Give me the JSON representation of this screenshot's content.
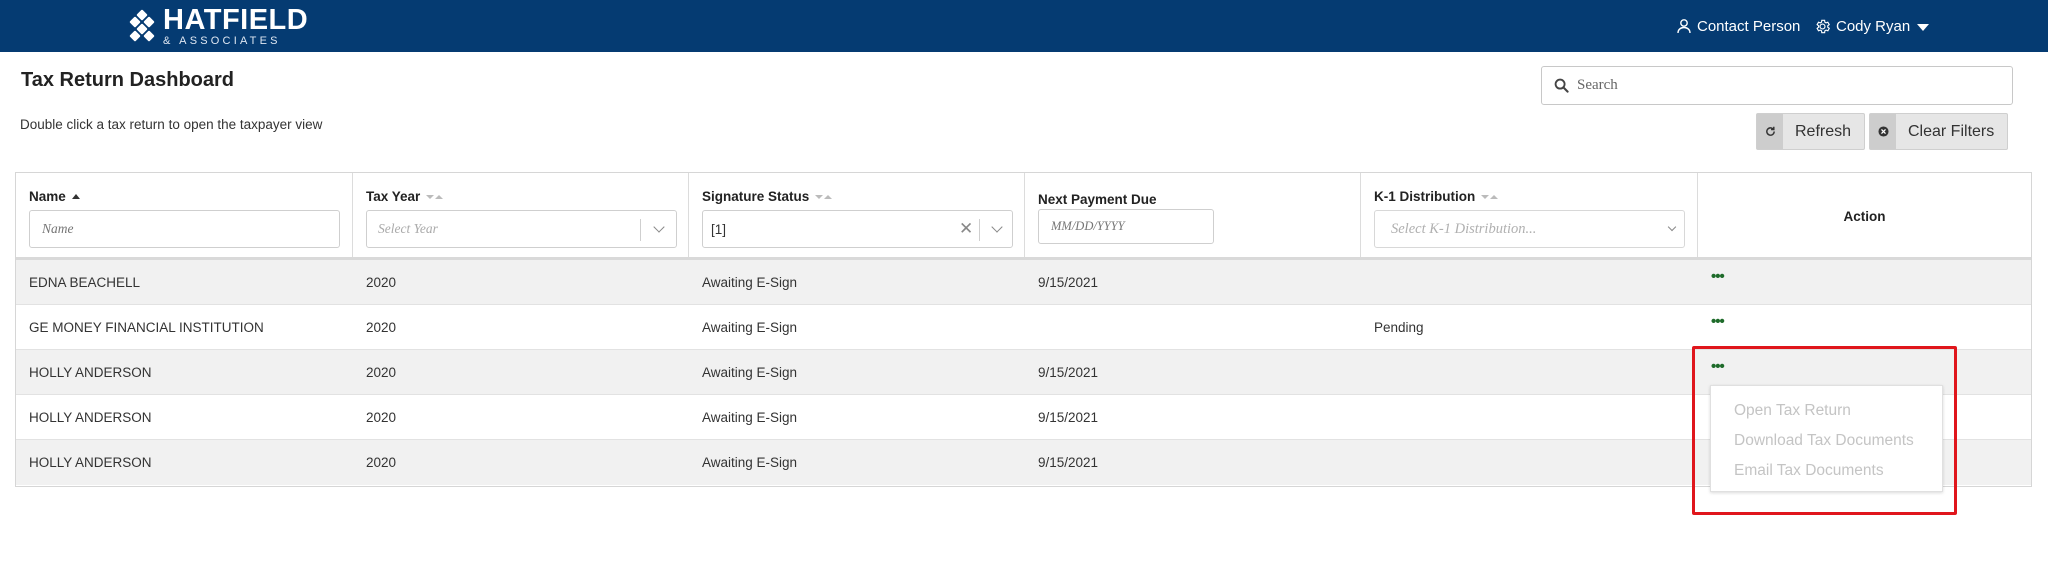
{
  "header": {
    "logo_title": "HATFIELD",
    "logo_subtitle": "& ASSOCIATES",
    "contact_label": "Contact Person",
    "user_label": "Cody Ryan"
  },
  "page": {
    "title": "Tax Return Dashboard",
    "subtitle": "Double click a tax return to open the taxpayer view"
  },
  "search": {
    "placeholder": "Search"
  },
  "toolbar": {
    "refresh_label": "Refresh",
    "clear_filters_label": "Clear Filters"
  },
  "table": {
    "columns": [
      {
        "label": "Name",
        "sort": "asc",
        "filter_placeholder": "Name"
      },
      {
        "label": "Tax Year",
        "sort": "none",
        "filter_placeholder": "Select Year"
      },
      {
        "label": "Signature Status",
        "sort": "none",
        "filter_value": "[1]"
      },
      {
        "label": "Next Payment Due",
        "filter_placeholder": "MM/DD/YYYY"
      },
      {
        "label": "K-1 Distribution",
        "sort": "none",
        "filter_placeholder": "Select K-1 Distribution..."
      },
      {
        "label": "Action"
      }
    ],
    "rows": [
      {
        "name": "EDNA BEACHELL",
        "tax_year": "2020",
        "signature_status": "Awaiting E-Sign",
        "next_payment_due": "9/15/2021",
        "k1": "",
        "action": "•••"
      },
      {
        "name": "GE MONEY FINANCIAL INSTITUTION",
        "tax_year": "2020",
        "signature_status": "Awaiting E-Sign",
        "next_payment_due": "",
        "k1": "Pending",
        "action": "•••"
      },
      {
        "name": "HOLLY ANDERSON",
        "tax_year": "2020",
        "signature_status": "Awaiting E-Sign",
        "next_payment_due": "9/15/2021",
        "k1": "",
        "action": "•••"
      },
      {
        "name": "HOLLY ANDERSON",
        "tax_year": "2020",
        "signature_status": "Awaiting E-Sign",
        "next_payment_due": "9/15/2021",
        "k1": "",
        "action": "•••"
      },
      {
        "name": "HOLLY ANDERSON",
        "tax_year": "2020",
        "signature_status": "Awaiting E-Sign",
        "next_payment_due": "9/15/2021",
        "k1": "",
        "action": "•••"
      }
    ]
  },
  "action_menu": {
    "items": [
      "Open Tax Return",
      "Download Tax Documents",
      "Email Tax Documents"
    ]
  },
  "colors": {
    "header_bg": "#053b72",
    "action_dots": "#1e6b2a",
    "highlight_border": "#e0161c"
  }
}
